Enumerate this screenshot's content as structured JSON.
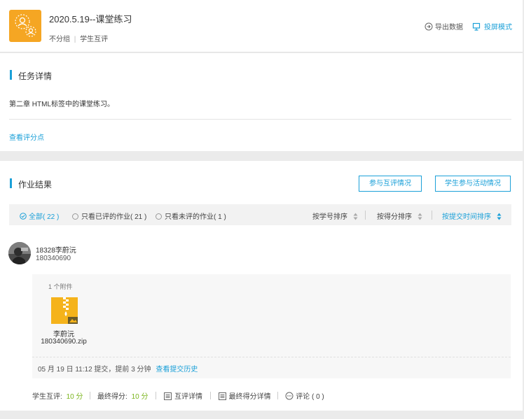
{
  "header": {
    "title": "2020.5.19--课堂练习",
    "group": "不分组",
    "mode": "学生互评",
    "export_label": "导出数据",
    "projection_label": "投屏模式"
  },
  "task": {
    "section_title": "任务详情",
    "description": "第二章 HTML标签中的课堂练习。",
    "view_scoring_link": "查看评分点"
  },
  "results": {
    "section_title": "作业结果",
    "peer_review_button": "参与互评情况",
    "activity_button": "学生参与活动情况",
    "filters": [
      {
        "label": "全部",
        "count": "( 22 )",
        "selected": true
      },
      {
        "label": "只看已评的作业",
        "count": "( 21 )",
        "selected": false
      },
      {
        "label": "只看未评的作业",
        "count": "( 1 )",
        "selected": false
      }
    ],
    "sorts": [
      {
        "label": "按学号排序",
        "active": false
      },
      {
        "label": "按得分排序",
        "active": false
      },
      {
        "label": "按提交时间排序",
        "active": true
      }
    ]
  },
  "submission": {
    "student_name": "18328李蔚沅",
    "student_id": "180340690",
    "attachments_count_label": "1 个附件",
    "file_name_line1": "李蔚沅",
    "file_name_line2": "180340690.zip",
    "submit_time": "05 月 19 日 11:12 提交，提前 3 分钟",
    "history_link": "查看提交历史",
    "peer_score_label": "学生互评:",
    "peer_score_value": "10 分",
    "final_score_label": "最终得分:",
    "final_score_value": "10 分",
    "peer_detail_label": "互评详情",
    "final_detail_label": "最终得分详情",
    "comment_label": "评论 ( 0 )"
  },
  "colors": {
    "accent": "#1ba0d8",
    "logo": "#f5a623",
    "score_green": "#7ab51d",
    "zip_yellow": "#f5b31b"
  }
}
